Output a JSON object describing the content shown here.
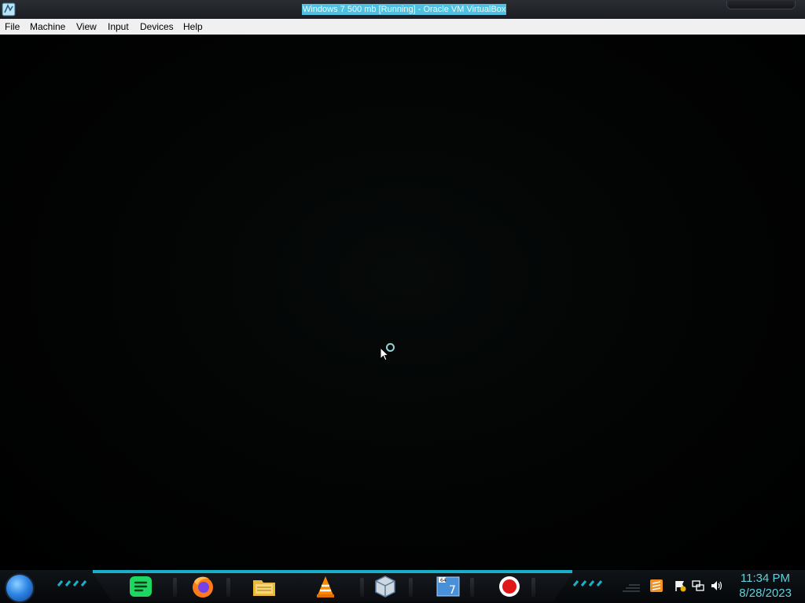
{
  "window": {
    "title": "Windows 7 500 mb [Running] - Oracle VM VirtualBox"
  },
  "menu": {
    "items": [
      "File",
      "Machine",
      "View",
      "Input",
      "Devices",
      "Help"
    ]
  },
  "vm_screen": {
    "state": "loading",
    "cursor": "busy-cursor"
  },
  "taskbar": {
    "start": "start-orb-icon",
    "apps": [
      "spotify-icon",
      "firefox-icon",
      "file-explorer-icon",
      "vlc-icon",
      "virtualbox-icon",
      "windows7-setup-icon",
      "screen-recorder-icon"
    ],
    "tray": [
      "sublime-icon",
      "action-center-flag-icon",
      "network-icon",
      "volume-icon"
    ],
    "clock": {
      "time": "11:34 PM",
      "date": "8/28/2023"
    }
  },
  "colors": {
    "accent": "#18b0c9",
    "clock_text": "#5fd2dd",
    "title_highlight": "#4fc0e0"
  }
}
